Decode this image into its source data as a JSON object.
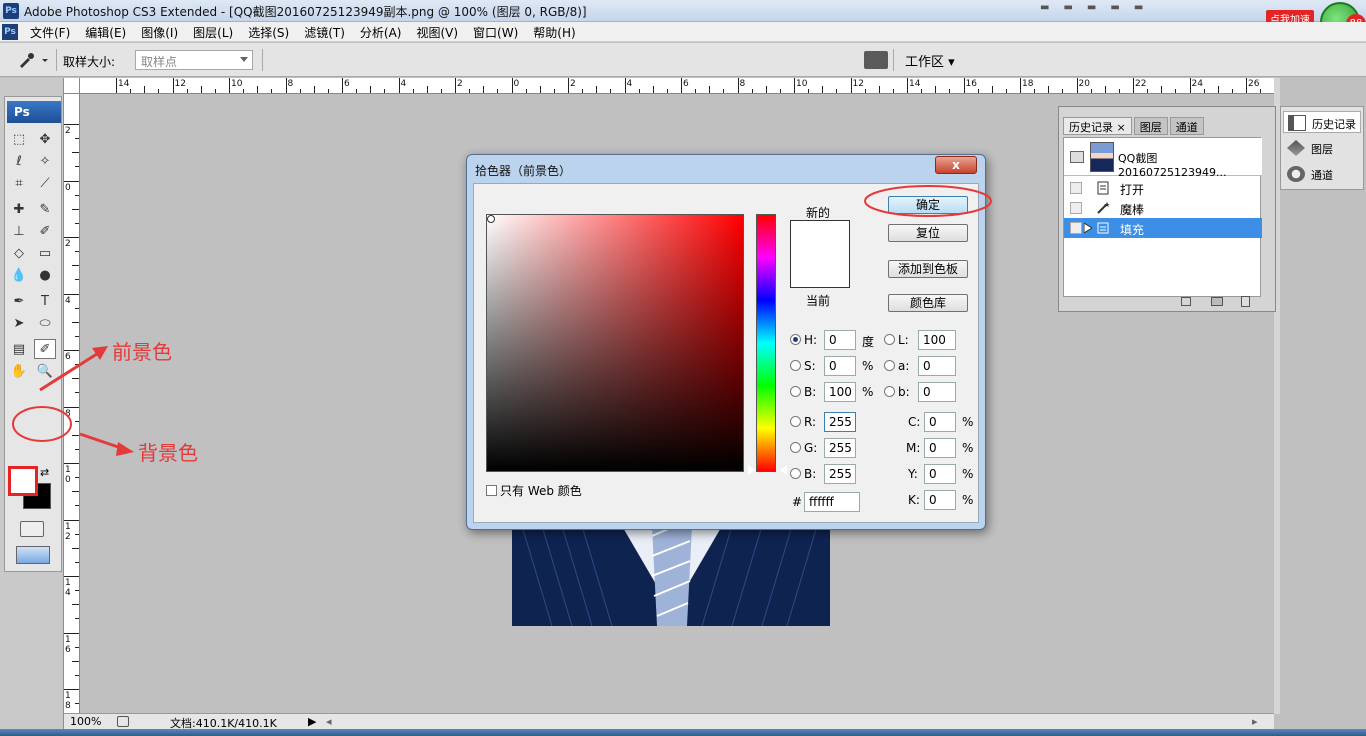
{
  "titlebar": {
    "app_icon": "Ps",
    "title": "Adobe Photoshop CS3 Extended - [QQ截图20160725123949副本.png @ 100% (图层 0, RGB/8)]"
  },
  "ad": {
    "label": "点我加速",
    "count": "88"
  },
  "menubar": {
    "items": [
      "文件(F)",
      "编辑(E)",
      "图像(I)",
      "图层(L)",
      "选择(S)",
      "滤镜(T)",
      "分析(A)",
      "视图(V)",
      "窗口(W)",
      "帮助(H)"
    ]
  },
  "options": {
    "sample_size_label": "取样大小:",
    "sample_size_value": "取样点",
    "workspace_label": "工作区"
  },
  "toolbox": {
    "ps_label": "Ps"
  },
  "rulers": {
    "top_labels": [
      "14",
      "12",
      "10",
      "8",
      "6",
      "4",
      "2",
      "0",
      "2",
      "4",
      "6",
      "8",
      "10",
      "12",
      "14",
      "16",
      "18",
      "20",
      "22",
      "24",
      "26"
    ],
    "left_labels": [
      "2",
      "0",
      "2",
      "4",
      "6",
      "8",
      "1 0",
      "1 2",
      "1 4",
      "1 6",
      "1 8"
    ]
  },
  "statusbar": {
    "zoom": "100%",
    "doc": "文档:410.1K/410.1K"
  },
  "history_panel": {
    "tabs": [
      "历史记录",
      "图层",
      "通道"
    ],
    "snapshot_name": "QQ截图20160725123949...",
    "rows": [
      {
        "label": "打开",
        "icon": "open-doc-icon",
        "selected": false
      },
      {
        "label": "魔棒",
        "icon": "magic-wand-icon",
        "selected": false
      },
      {
        "label": "填充",
        "icon": "fill-icon",
        "selected": true
      }
    ]
  },
  "side_panel": {
    "items": [
      {
        "label": "历史记录",
        "icon": "history-icon"
      },
      {
        "label": "图层",
        "icon": "layers-icon"
      },
      {
        "label": "通道",
        "icon": "channels-icon"
      }
    ]
  },
  "color_picker": {
    "title": "拾色器（前景色）",
    "close": "x",
    "new_label": "新的",
    "current_label": "当前",
    "new_color": "#ffffff",
    "current_color": "#ffffff",
    "buttons": {
      "ok": "确定",
      "reset": "复位",
      "add_swatch": "添加到色板",
      "libraries": "颜色库"
    },
    "hsb": {
      "h_label": "H:",
      "h_value": "0",
      "h_unit": "度",
      "s_label": "S:",
      "s_value": "0",
      "s_unit": "%",
      "b_label": "B:",
      "b_value": "100",
      "b_unit": "%"
    },
    "rgb": {
      "r_label": "R:",
      "r_value": "255",
      "g_label": "G:",
      "g_value": "255",
      "b_label": "B:",
      "b_value": "255"
    },
    "lab": {
      "l_label": "L:",
      "l_value": "100",
      "a_label": "a:",
      "a_value": "0",
      "b_label": "b:",
      "b_value": "0"
    },
    "cmyk": {
      "c_label": "C:",
      "c_value": "0",
      "m_label": "M:",
      "m_value": "0",
      "y_label": "Y:",
      "y_value": "0",
      "k_label": "K:",
      "k_value": "0",
      "unit": "%"
    },
    "hex_label": "#",
    "hex_value": "ffffff",
    "web_only_label": "只有 Web 颜色"
  },
  "annotations": {
    "foreground": "前景色",
    "background": "背景色"
  },
  "colors": {
    "highlight": "#3d8ee6",
    "annotation_red": "#e43a3a",
    "foreground": "#ffffff",
    "background": "#000000"
  }
}
